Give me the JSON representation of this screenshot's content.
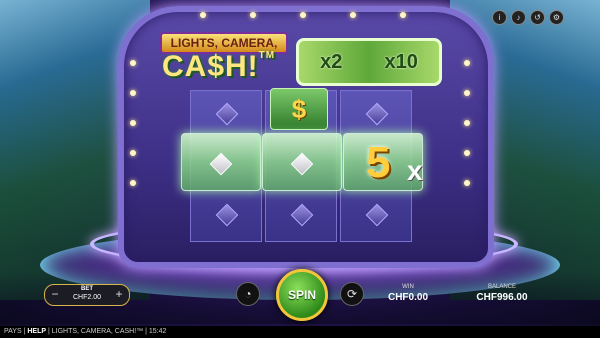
{
  "logo": {
    "top_text": "LIGHTS, CAMERA,",
    "main_text": "CA$H!",
    "tm": "TM"
  },
  "multiplier": {
    "left": "x2",
    "right": "x10"
  },
  "reels": {
    "top_symbol": "$",
    "feature_number": "5",
    "feature_mark": "x"
  },
  "top_icons": [
    "info-icon",
    "sound-icon",
    "history-icon",
    "settings-icon"
  ],
  "hud": {
    "bet_label": "BET",
    "bet_value": "CHF2.00",
    "bet_minus": "−",
    "bet_plus": "+",
    "spin_label": "SPIN",
    "win_label": "WIN",
    "win_value": "CHF0.00",
    "balance_label": "BALANCE",
    "balance_value": "CHF996.00"
  },
  "footer": {
    "pays": "PAYS",
    "help": "HELP",
    "game_name": "LIGHTS, CAMERA, CASH!™",
    "time": "15:42"
  }
}
